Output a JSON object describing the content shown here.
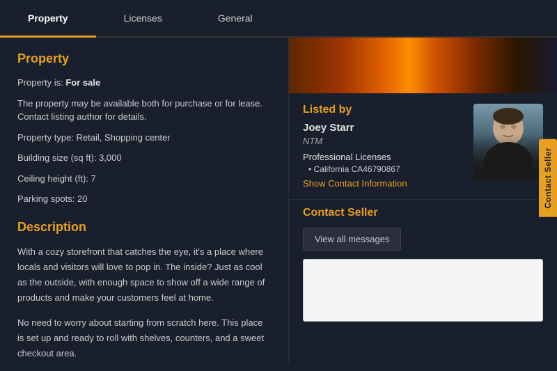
{
  "tabs": [
    {
      "label": "Property",
      "active": true
    },
    {
      "label": "Licenses",
      "active": false
    },
    {
      "label": "General",
      "active": false
    }
  ],
  "property_section": {
    "title": "Property",
    "fields": [
      {
        "label": "Property is:",
        "value": "For sale"
      },
      {
        "label": "note",
        "value": "The property may be available both for purchase or for lease. Contact listing author for details."
      },
      {
        "label": "Property type:",
        "value": "Retail, Shopping center"
      },
      {
        "label": "Building size (sq ft):",
        "value": "3,000"
      },
      {
        "label": "Ceiling height (ft):",
        "value": "7"
      },
      {
        "label": "Parking spots:",
        "value": "20"
      }
    ]
  },
  "description_section": {
    "title": "Description",
    "paragraphs": [
      "With a cozy storefront that catches the eye, it's a place where locals and visitors will love to pop in. The inside? Just as cool as the outside, with enough space to show off a wide range of products and make your customers feel at home.",
      "No need to worry about starting from scratch here. This place is set up and ready to roll with shelves, counters, and a sweet checkout area."
    ]
  },
  "listed_by": {
    "title": "Listed by",
    "agent_name": "Joey Starr",
    "agent_company": "NTM",
    "licenses_title": "Professional Licenses",
    "licenses": [
      "California CA46790867"
    ],
    "show_contact_label": "Show Contact Information"
  },
  "contact_seller": {
    "title": "Contact Seller",
    "view_messages_label": "View all messages",
    "tab_label": "Contact Seller"
  }
}
